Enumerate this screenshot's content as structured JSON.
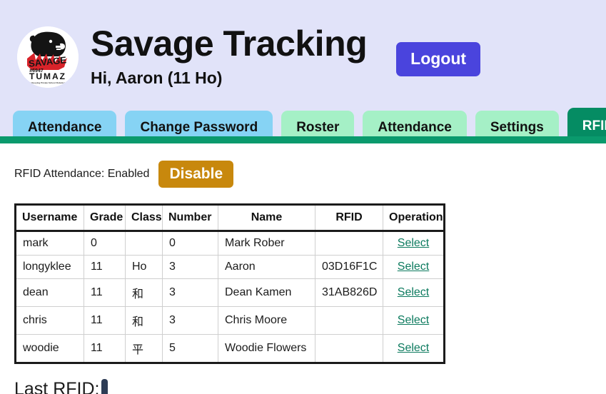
{
  "header": {
    "title": "Savage Tracking",
    "greeting": "Hi, Aaron (11 Ho)",
    "logout_label": "Logout",
    "logo": {
      "name": "savage-tumaz-bear-logo",
      "wordmark": "SAVAGE",
      "team_number": "#6947",
      "team_name": "TUMAZ",
      "tagline": "Taipei Kuoying Private School Robotics Club"
    },
    "colors": {
      "band_background": "#e1e3f9",
      "logout_button": "#4a44dd",
      "accent_green": "#0a9a6d",
      "active_tab": "#058c63",
      "tab_blue": "#86d3f4",
      "tab_green": "#a5f0c6"
    }
  },
  "tabs": [
    {
      "label": "Attendance",
      "style": "blue",
      "active": false
    },
    {
      "label": "Change Password",
      "style": "blue",
      "active": false
    },
    {
      "label": "Roster",
      "style": "green",
      "active": false
    },
    {
      "label": "Attendance",
      "style": "green",
      "active": false
    },
    {
      "label": "Settings",
      "style": "green",
      "active": false
    },
    {
      "label": "RFID",
      "style": "green",
      "active": true
    }
  ],
  "main": {
    "rfid_status_text": "RFID Attendance: Enabled",
    "toggle_button_label": "Disable",
    "toggle_button_color": "#c8880d",
    "table": {
      "columns": [
        "Username",
        "Grade",
        "Class",
        "Number",
        "Name",
        "RFID",
        "Operation"
      ],
      "rows": [
        {
          "username": "mark",
          "grade": "0",
          "class": "",
          "number": "0",
          "name": "Mark Rober",
          "rfid": "",
          "operation": "Select"
        },
        {
          "username": "longyklee",
          "grade": "11",
          "class": "Ho",
          "number": "3",
          "name": "Aaron",
          "rfid": "03D16F1C",
          "operation": "Select"
        },
        {
          "username": "dean",
          "grade": "11",
          "class": "和",
          "number": "3",
          "name": "Dean Kamen",
          "rfid": "31AB826D",
          "operation": "Select"
        },
        {
          "username": "chris",
          "grade": "11",
          "class": "和",
          "number": "3",
          "name": "Chris Moore",
          "rfid": "",
          "operation": "Select"
        },
        {
          "username": "woodie",
          "grade": "11",
          "class": "平",
          "number": "5",
          "name": "Woodie Flowers",
          "rfid": "",
          "operation": "Select"
        }
      ]
    },
    "last_rfid_label": "Last RFID:",
    "last_rfid_value": ""
  }
}
